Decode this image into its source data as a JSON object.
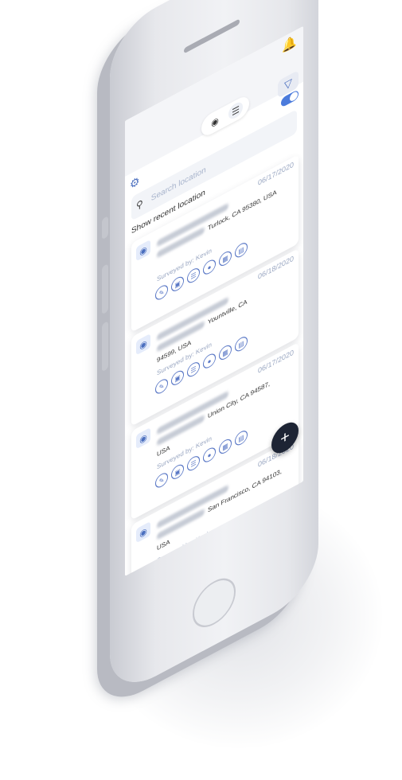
{
  "header": {
    "notification_icon": "bell-icon"
  },
  "view_toggle": {
    "map_icon": "map-pin-icon",
    "list_icon": "list-icon"
  },
  "filter_icon": "filter-icon",
  "settings_icon": "gear-icon",
  "search": {
    "placeholder": "Search location"
  },
  "recent": {
    "label": "Show recent location"
  },
  "cards": [
    {
      "date": "06/17/2020",
      "address": "Turlock, CA 95380, USA",
      "surveyed": "Surveyed by: Kevin"
    },
    {
      "date": "06/18/2020",
      "address": "Yountville, CA",
      "address2": "94599, USA",
      "surveyed": "Surveyed by: Kevin"
    },
    {
      "date": "06/17/2020",
      "address": "Union City, CA 94587,",
      "address2": "USA",
      "surveyed": "Surveyed by: Kevin"
    },
    {
      "date": "06/18/2020",
      "address": "San Francisco, CA 94103,",
      "address2": "USA",
      "surveyed": "Surveyed by: Kevin"
    }
  ],
  "fab": {
    "label": "+"
  },
  "colors": {
    "accent": "#4b6fbf",
    "fab": "#1d2434",
    "switch_on": "#4b7bdc"
  }
}
